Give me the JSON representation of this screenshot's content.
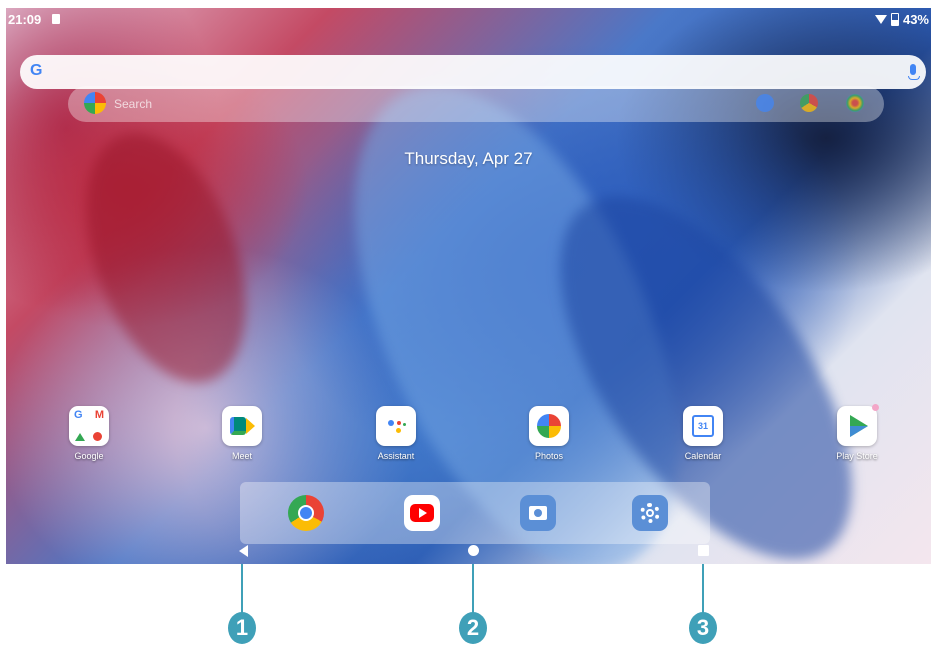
{
  "status_bar": {
    "time": "21:09",
    "battery": "43%"
  },
  "search_bar": {
    "logo": "G",
    "voice_icon": "mic-icon"
  },
  "ghost_search": {
    "text": "Search"
  },
  "date_text": "Thursday, Apr 27",
  "apps": [
    {
      "label": "Google",
      "icon": "google-folder-icon"
    },
    {
      "label": "Meet",
      "icon": "meet-icon"
    },
    {
      "label": "Assistant",
      "icon": "assistant-icon"
    },
    {
      "label": "Photos",
      "icon": "photos-icon"
    },
    {
      "label": "Calendar",
      "icon": "calendar-icon",
      "day": "31"
    },
    {
      "label": "Play Store",
      "icon": "play-store-icon"
    }
  ],
  "dock": [
    {
      "icon": "chrome-icon"
    },
    {
      "icon": "youtube-icon"
    },
    {
      "icon": "camera-icon"
    },
    {
      "icon": "settings-icon"
    }
  ],
  "callouts": [
    "1",
    "2",
    "3"
  ],
  "colors": {
    "callout": "#3fa0b8",
    "google_blue": "#4285f4"
  }
}
